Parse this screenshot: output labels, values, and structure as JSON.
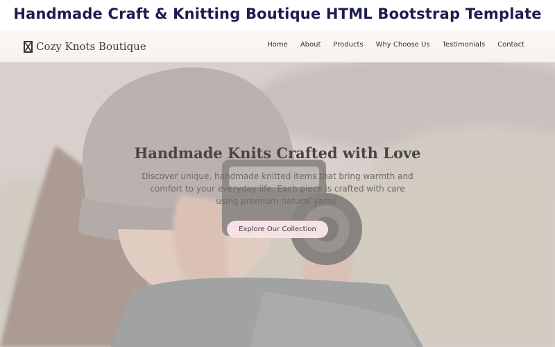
{
  "banner": {
    "title": "Handmade Craft & Knitting Boutique HTML Bootstrap Template"
  },
  "navbar": {
    "brand": "Cozy Knots Boutique",
    "brand_icon": "hourglass-icon",
    "links": [
      "Home",
      "About",
      "Products",
      "Why Choose Us",
      "Testimonials",
      "Contact"
    ]
  },
  "hero": {
    "title": "Handmade Knits Crafted with Love",
    "description": "Discover unique, handmade knitted items that bring warmth and comfort to your everyday life. Each piece is crafted with care using premium natural yarns.",
    "cta": "Explore Our Collection"
  },
  "colors": {
    "banner_text": "#1c1c4f",
    "button_bg": "#f6e2e4",
    "nav_bg": "#f7f2ec"
  }
}
